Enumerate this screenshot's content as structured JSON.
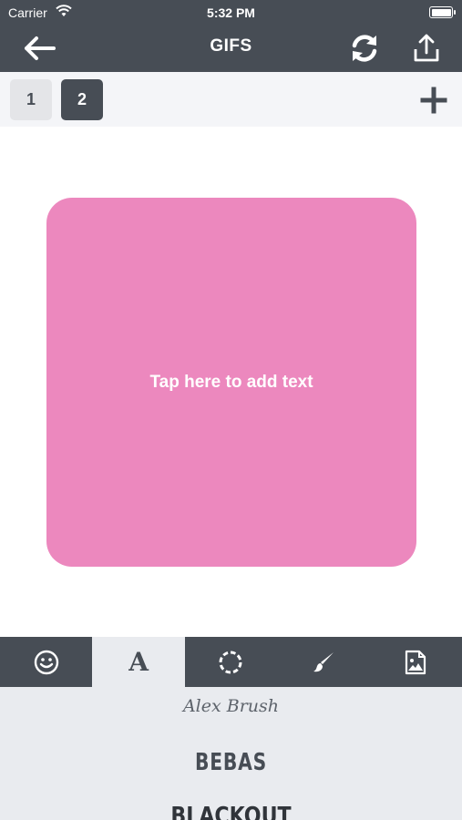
{
  "status": {
    "carrier": "Carrier",
    "time": "5:32 PM"
  },
  "nav": {
    "title": "GIFS"
  },
  "pages": {
    "tabs": [
      "1",
      "2"
    ],
    "active_index": 1
  },
  "canvas": {
    "placeholder": "Tap here to add text",
    "color": "#ec88be"
  },
  "toolbar": {
    "tools": [
      "emoji-icon",
      "text-font-icon",
      "frame-circle-icon",
      "brush-icon",
      "image-icon"
    ],
    "font_tool_label": "A",
    "active": "text-font-icon"
  },
  "fonts": {
    "items": [
      "Alex Brush",
      "BEBAS",
      "BLACKOUT"
    ]
  },
  "colors": {
    "bar": "#474d55",
    "panel": "#e9ebef",
    "canvas": "#ec88be"
  }
}
